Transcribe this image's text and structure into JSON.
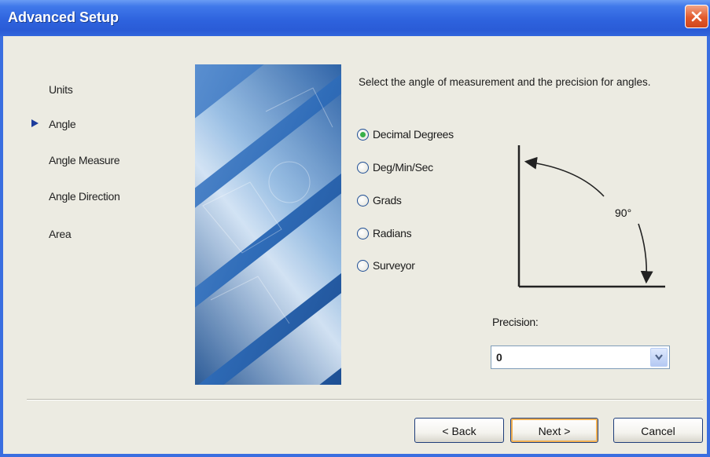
{
  "window": {
    "title": "Advanced Setup"
  },
  "steps": {
    "items": [
      {
        "label": "Units"
      },
      {
        "label": "Angle",
        "current": true
      },
      {
        "label": "Angle Measure"
      },
      {
        "label": "Angle Direction"
      },
      {
        "label": "Area"
      }
    ]
  },
  "content": {
    "instruction": "Select the angle of measurement and the precision for angles."
  },
  "angle_options": [
    {
      "label": "Decimal Degrees",
      "checked": true
    },
    {
      "label": "Deg/Min/Sec",
      "checked": false
    },
    {
      "label": "Grads",
      "checked": false
    },
    {
      "label": "Radians",
      "checked": false
    },
    {
      "label": "Surveyor",
      "checked": false
    }
  ],
  "diagram": {
    "angle_label": "90°"
  },
  "precision": {
    "label": "Precision:",
    "value": "0"
  },
  "buttons": {
    "back": "< Back",
    "next": "Next >",
    "cancel": "Cancel"
  },
  "colors": {
    "titlebar": "#2e63de",
    "radio_selected": "#38b048",
    "default_button_highlight": "#f3b254"
  },
  "icons": {
    "close": "close-icon",
    "current_step": "current-step-arrow-icon",
    "dropdown": "chevron-down-icon"
  }
}
